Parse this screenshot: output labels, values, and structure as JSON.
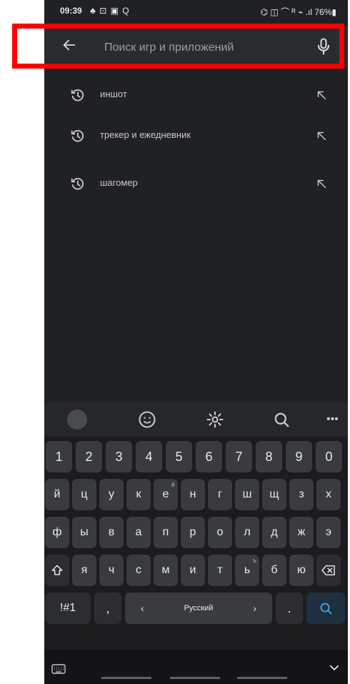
{
  "status_bar": {
    "time": "09:39",
    "left_icons": "♣ ⊡ ▣ Q",
    "right_icons": "⌬ ◫ ⌒ ᴿ ⌁ .ıl 76%▮"
  },
  "search_bar": {
    "placeholder": "Поиск игр и приложений"
  },
  "suggestions": [
    {
      "label": "иншот"
    },
    {
      "label": "трекер и ежедневник"
    },
    {
      "label": "шагомер"
    }
  ],
  "keyboard": {
    "row_numbers": [
      "1",
      "2",
      "3",
      "4",
      "5",
      "6",
      "7",
      "8",
      "9",
      "0"
    ],
    "row1": [
      "й",
      "ц",
      "у",
      "к",
      "е",
      "н",
      "г",
      "ш",
      "щ",
      "з",
      "х"
    ],
    "row1_hints": [
      "",
      "",
      "",
      "",
      "ё",
      "",
      "",
      "",
      "",
      "",
      ""
    ],
    "row2": [
      "ф",
      "ы",
      "в",
      "а",
      "п",
      "р",
      "о",
      "л",
      "д",
      "ж",
      "э"
    ],
    "row3": [
      "я",
      "ч",
      "с",
      "м",
      "и",
      "т",
      "ь",
      "б",
      "ю"
    ],
    "row3_hints": [
      "",
      "",
      "",
      "",
      "",
      "",
      "ъ",
      "",
      ""
    ],
    "symbols_label": "!#1",
    "comma_label": ",",
    "space_label": "Русский",
    "space_left": "‹",
    "space_right": "›",
    "period_label": ".",
    "toolbar_more": "•••"
  },
  "colors": {
    "background": "#202124",
    "highlight": "#ff0000",
    "accent": "#4aa3df"
  }
}
